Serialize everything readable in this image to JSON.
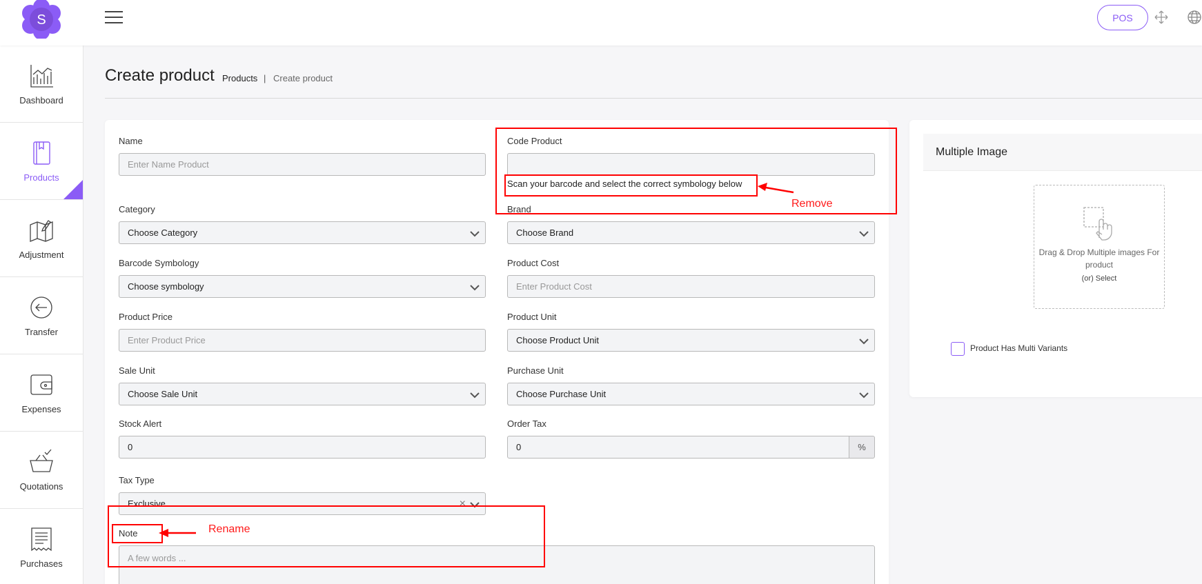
{
  "brand": {
    "logo_letter": "S",
    "accent": "#8b5cf6"
  },
  "topbar": {
    "pos_label": "POS"
  },
  "sidebar": {
    "items": [
      {
        "label": "Dashboard",
        "icon": "chart-icon"
      },
      {
        "label": "Products",
        "icon": "book-icon",
        "active": true
      },
      {
        "label": "Adjustment",
        "icon": "map-edit-icon"
      },
      {
        "label": "Transfer",
        "icon": "arrow-left-circle-icon"
      },
      {
        "label": "Expenses",
        "icon": "wallet-icon"
      },
      {
        "label": "Quotations",
        "icon": "basket-icon"
      },
      {
        "label": "Purchases",
        "icon": "receipt-icon"
      }
    ]
  },
  "page": {
    "title": "Create product",
    "breadcrumb": {
      "parent": "Products",
      "separator": "|",
      "current": "Create product"
    }
  },
  "form": {
    "name": {
      "label": "Name",
      "placeholder": "Enter Name Product"
    },
    "code": {
      "label": "Code Product",
      "value": "",
      "help": "Scan your barcode and select the correct symbology below"
    },
    "category": {
      "label": "Category",
      "value": "Choose Category"
    },
    "brand": {
      "label": "Brand",
      "value": "Choose Brand"
    },
    "barcode_symbology": {
      "label": "Barcode Symbology",
      "value": "Choose symbology"
    },
    "product_cost": {
      "label": "Product Cost",
      "placeholder": "Enter Product Cost"
    },
    "product_price": {
      "label": "Product Price",
      "placeholder": "Enter Product Price"
    },
    "product_unit": {
      "label": "Product Unit",
      "value": "Choose Product Unit"
    },
    "sale_unit": {
      "label": "Sale Unit",
      "value": "Choose Sale Unit"
    },
    "purchase_unit": {
      "label": "Purchase Unit",
      "value": "Choose Purchase Unit"
    },
    "stock_alert": {
      "label": "Stock Alert",
      "value": "0"
    },
    "order_tax": {
      "label": "Order Tax",
      "value": "0",
      "suffix": "%"
    },
    "tax_type": {
      "label": "Tax Type",
      "value": "Exclusive",
      "clear": "×"
    },
    "note": {
      "label": "Note",
      "placeholder": "A few words ..."
    }
  },
  "images": {
    "title": "Multiple Image",
    "dropzone_text": "Drag & Drop Multiple images For product",
    "select_text": "(or) Select",
    "multi_variants_label": "Product Has Multi Variants"
  },
  "annotations": {
    "remove": "Remove",
    "rename": "Rename",
    "color": "#ff0000"
  }
}
